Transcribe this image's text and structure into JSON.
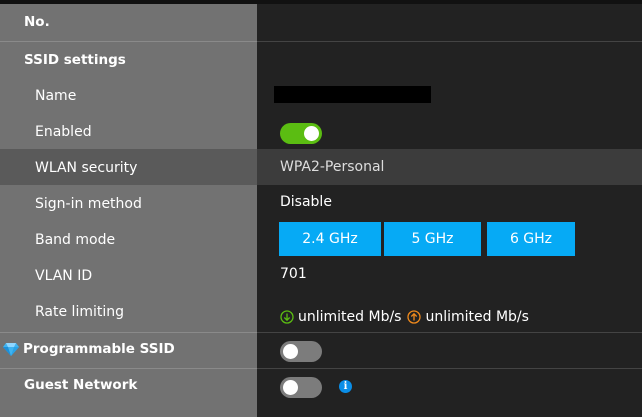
{
  "header": {
    "no_label": "No."
  },
  "ssid_settings": {
    "title": "SSID settings",
    "rows": {
      "name": {
        "label": "Name",
        "value": ""
      },
      "enabled": {
        "label": "Enabled",
        "value": true
      },
      "wlan_security": {
        "label": "WLAN security",
        "value": "WPA2-Personal"
      },
      "sign_in_method": {
        "label": "Sign-in method",
        "value": "Disable"
      },
      "band_mode": {
        "label": "Band mode",
        "options": [
          "2.4 GHz",
          "5 GHz",
          "6 GHz"
        ]
      },
      "vlan_id": {
        "label": "VLAN ID",
        "value": "701"
      },
      "rate_limiting": {
        "label": "Rate limiting",
        "download": "unlimited Mb/s",
        "upload": "unlimited Mb/s"
      }
    }
  },
  "programmable_ssid": {
    "label": "Programmable SSID",
    "enabled": false,
    "icon": "diamond-icon"
  },
  "guest_network": {
    "label": "Guest Network",
    "enabled": false,
    "info_icon": "info-icon",
    "info_glyph": "i"
  },
  "colors": {
    "toggle_on": "#5bbd12",
    "toggle_off": "#7c7c7c",
    "band_button": "#06aaf5",
    "download_arrow": "#5bbd12",
    "upload_arrow": "#f08a1c",
    "info": "#0a8ee8"
  }
}
